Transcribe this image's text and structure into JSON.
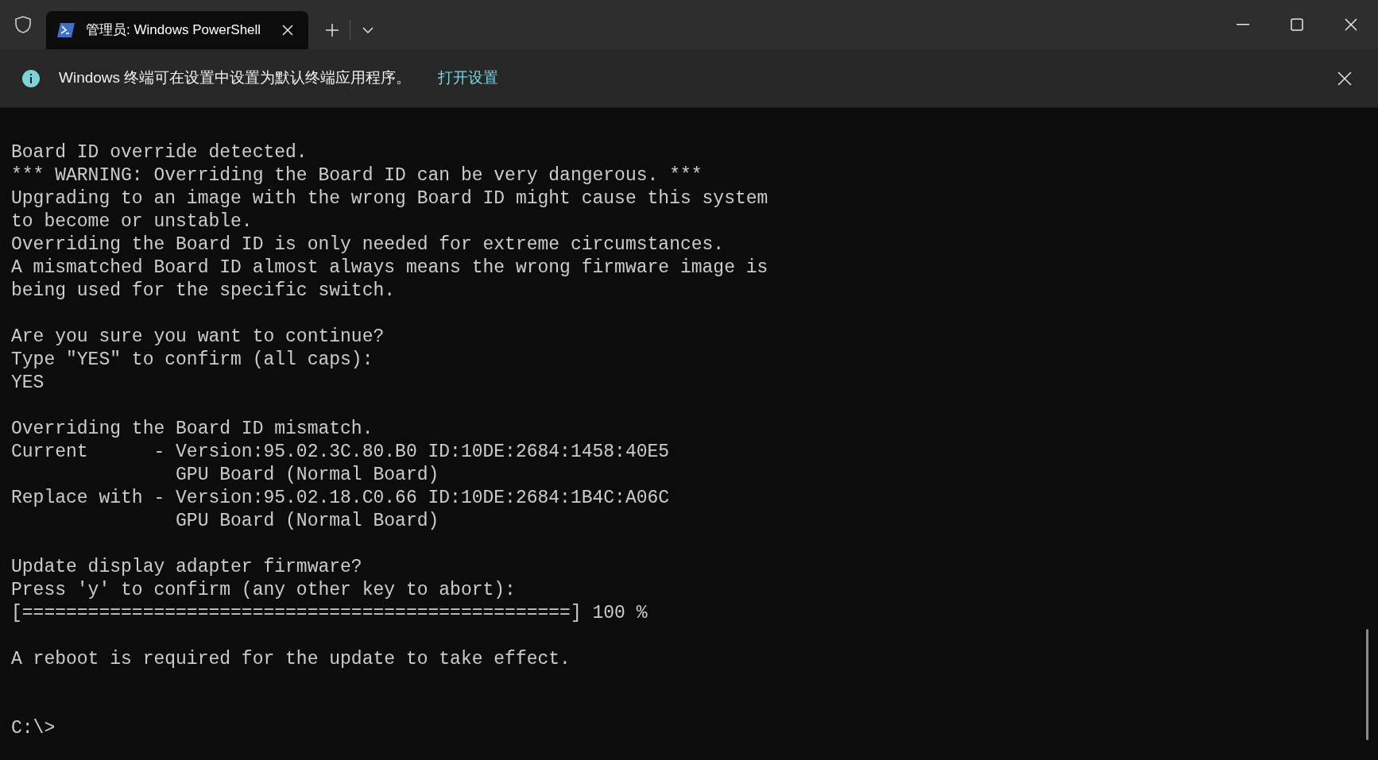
{
  "title_bar": {
    "tabs": [
      {
        "title": "管理员: Windows PowerShell",
        "selected": true
      }
    ]
  },
  "info_bar": {
    "message": "Windows 终端可在设置中设置为默认终端应用程序。",
    "link": "打开设置"
  },
  "terminal": {
    "blocks": [
      [
        "Board ID override detected.",
        "*** WARNING: Overriding the Board ID can be very dangerous. ***",
        "Upgrading to an image with the wrong Board ID might cause this system",
        "to become or unstable.",
        "Overriding the Board ID is only needed for extreme circumstances.",
        "A mismatched Board ID almost always means the wrong firmware image is",
        "being used for the specific switch."
      ],
      [
        "Are you sure you want to continue?",
        "Type \"YES\" to confirm (all caps):",
        "YES"
      ],
      [
        "Overriding the Board ID mismatch.",
        "Current      - Version:95.02.3C.80.B0 ID:10DE:2684:1458:40E5",
        "               GPU Board (Normal Board)",
        "Replace with - Version:95.02.18.C0.66 ID:10DE:2684:1B4C:A06C",
        "               GPU Board (Normal Board)"
      ],
      [
        "Update display adapter firmware?",
        "Press 'y' to confirm (any other key to abort):",
        "[==================================================] 100 %"
      ],
      [
        "A reboot is required for the update to take effect."
      ]
    ],
    "prompt": "C:\\>"
  }
}
